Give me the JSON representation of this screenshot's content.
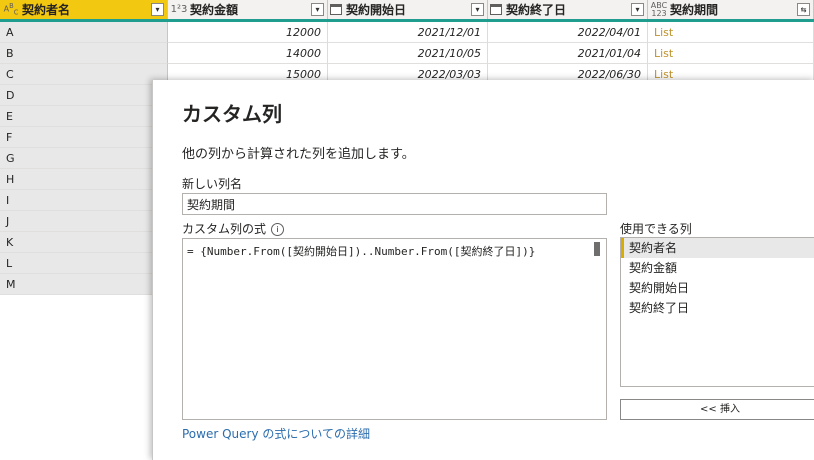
{
  "columns": [
    {
      "type_icon": "A^B_C",
      "label": "契約者名",
      "icon_name": "text-type-icon"
    },
    {
      "type_icon": "1²3",
      "label": "契約金額",
      "icon_name": "number-type-icon"
    },
    {
      "type_icon": "",
      "label": "契約開始日",
      "icon_name": "date-type-icon"
    },
    {
      "type_icon": "",
      "label": "契約終了日",
      "icon_name": "date-type-icon"
    },
    {
      "type_icon": "ABC 123",
      "label": "契約期間",
      "icon_name": "any-type-icon"
    }
  ],
  "rows": [
    {
      "name": "A",
      "amount": "12000",
      "start": "2021/12/01",
      "end": "2022/04/01",
      "period": "List"
    },
    {
      "name": "B",
      "amount": "14000",
      "start": "2021/10/05",
      "end": "2021/01/04",
      "period": "List"
    },
    {
      "name": "C",
      "amount": "15000",
      "start": "2022/03/03",
      "end": "2022/06/30",
      "period": "List"
    },
    {
      "name": "D"
    },
    {
      "name": "E"
    },
    {
      "name": "F"
    },
    {
      "name": "G"
    },
    {
      "name": "H"
    },
    {
      "name": "I"
    },
    {
      "name": "J"
    },
    {
      "name": "K"
    },
    {
      "name": "L"
    },
    {
      "name": "M"
    }
  ],
  "dialog": {
    "title": "カスタム列",
    "subtitle": "他の列から計算された列を追加します。",
    "new_col_label": "新しい列名",
    "new_col_value": "契約期間",
    "formula_label": "カスタム列の式",
    "formula": "= {Number.From([契約開始日])..Number.From([契約終了日])}",
    "available_label": "使用できる列",
    "available": [
      "契約者名",
      "契約金額",
      "契約開始日",
      "契約終了日"
    ],
    "insert_button": "<< 挿入",
    "link": "Power Query の式についての詳細"
  },
  "colors": {
    "selected_header": "#f2c811",
    "accent": "#1f9e8f",
    "link": "#2b6dad",
    "list": "#c0922c"
  }
}
